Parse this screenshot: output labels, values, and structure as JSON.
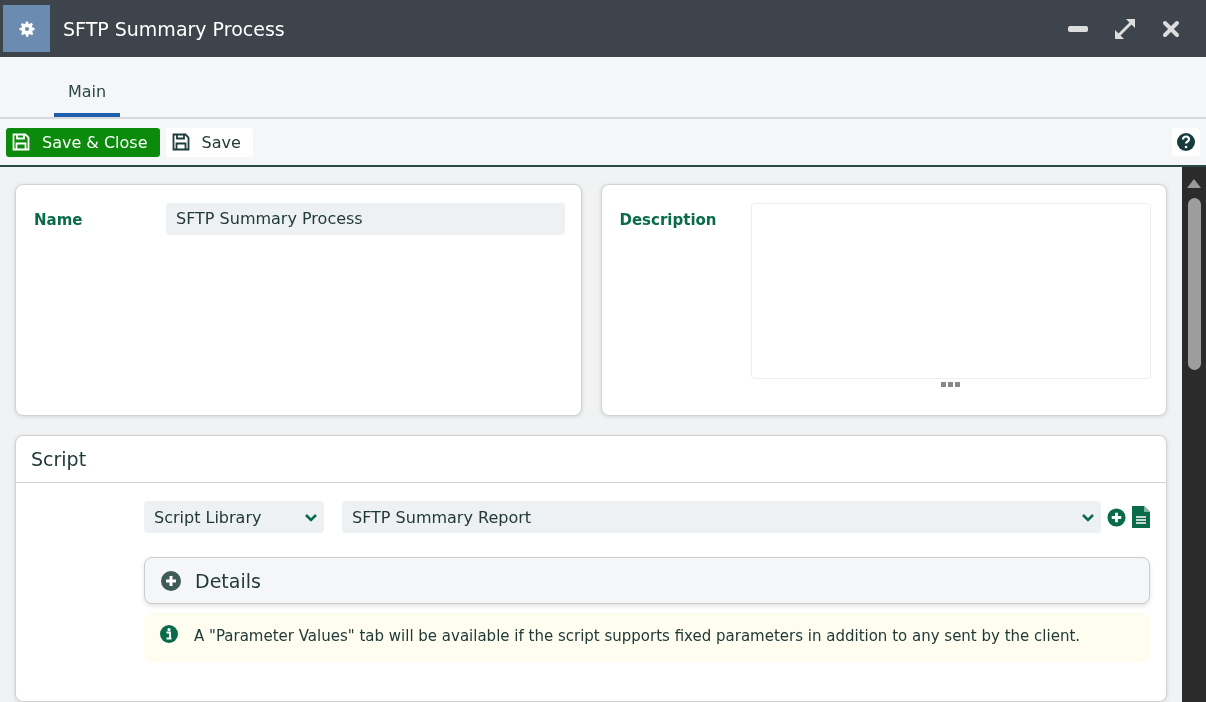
{
  "window": {
    "title": "SFTP Summary Process"
  },
  "tabs": [
    {
      "label": "Main",
      "selected": true
    }
  ],
  "toolbar": {
    "buttons": [
      {
        "label": "Save & Close",
        "kind": "primary"
      },
      {
        "label": "Save",
        "kind": "plain"
      }
    ]
  },
  "name_card": {
    "label": "Name",
    "value": "SFTP Summary Process"
  },
  "description_card": {
    "label": "Description"
  },
  "script": {
    "title": "Script",
    "source": "Script Library",
    "script_name": "SFTP Summary Report",
    "details": {
      "label": "Details",
      "expanded": false
    },
    "info": "A \"Parameter Values\" tab will be available if the script supports fixed parameters in addition to any sent by the client."
  }
}
